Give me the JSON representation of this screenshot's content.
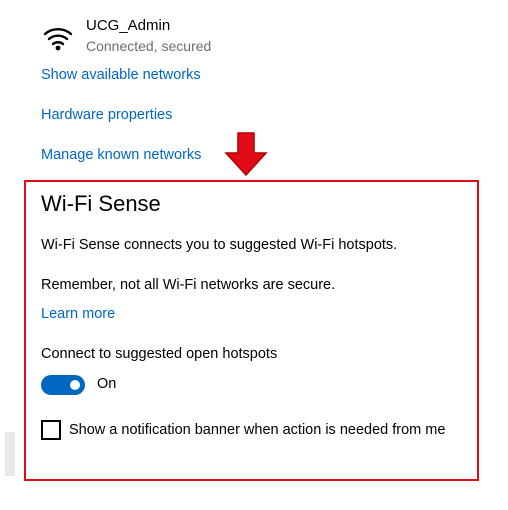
{
  "network": {
    "name": "UCG_Admin",
    "status": "Connected, secured",
    "icon": "wifi-signal-icon"
  },
  "links": {
    "show_available": "Show available networks",
    "hardware_properties": "Hardware properties",
    "manage_known": "Manage known networks"
  },
  "wifi_sense": {
    "title": "Wi-Fi Sense",
    "description": "Wi-Fi Sense connects you to suggested Wi-Fi hotspots.",
    "warning": "Remember, not all Wi-Fi networks are secure.",
    "learn_more": "Learn more",
    "connect_label": "Connect to suggested open hotspots",
    "toggle_state": "On",
    "toggle_on": true,
    "notification_label": "Show a notification banner when action is needed from me",
    "notification_checked": false
  },
  "colors": {
    "accent": "#0067c0",
    "highlight": "#e30b17",
    "secondary_text": "#6d6d6d"
  }
}
